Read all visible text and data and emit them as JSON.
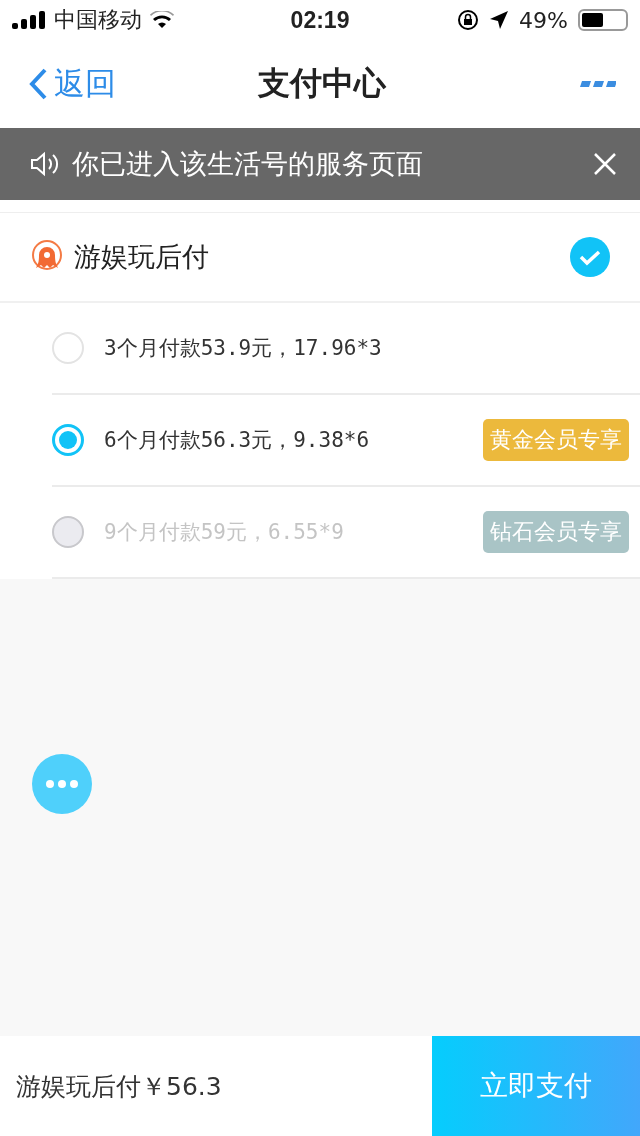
{
  "status_bar": {
    "carrier": "中国移动",
    "time": "02:19",
    "battery_text": "49%"
  },
  "nav": {
    "back": "返回",
    "title": "支付中心"
  },
  "toast": {
    "text": "你已进入该生活号的服务页面"
  },
  "payment_method": {
    "name": "游娱玩后付",
    "checked": true
  },
  "options": [
    {
      "label": "3个月付款53.9元，17.96*3",
      "selected": false,
      "disabled": false
    },
    {
      "label": "6个月付款56.3元，9.38*6",
      "selected": true,
      "disabled": false,
      "badge": "黄金会员专享",
      "color": "#ecb93c"
    },
    {
      "label": "9个月付款59元，6.55*9",
      "selected": false,
      "disabled": true,
      "badge": "钻石会员专享",
      "color": "#a9c4c6"
    }
  ],
  "footer": {
    "summary": "游娱玩后付￥56.3",
    "pay_button": "立即支付"
  }
}
